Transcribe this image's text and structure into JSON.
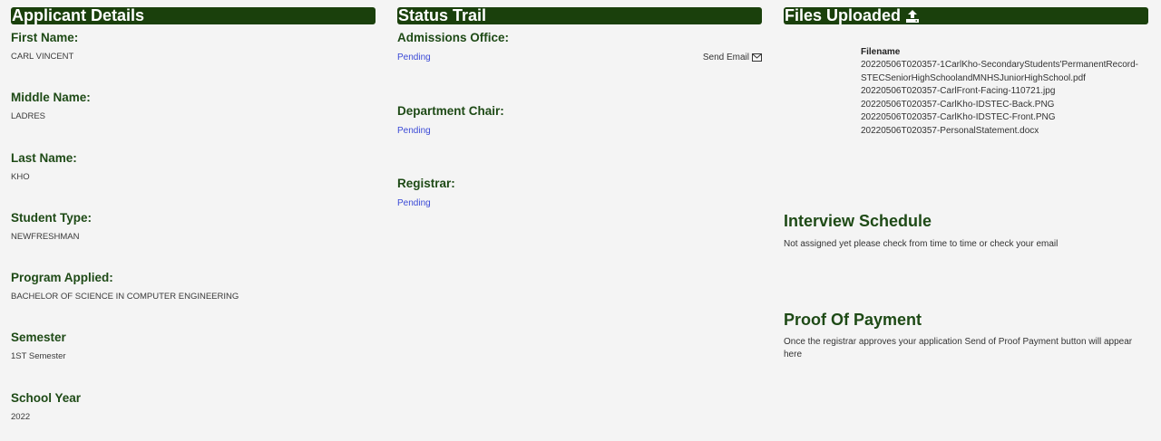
{
  "applicant": {
    "header": "Applicant Details",
    "fields": [
      {
        "label": "First Name:",
        "value": "CARL VINCENT"
      },
      {
        "label": "Middle Name:",
        "value": "LADRES"
      },
      {
        "label": "Last Name:",
        "value": "KHO"
      },
      {
        "label": "Student Type:",
        "value": "NEWFRESHMAN"
      },
      {
        "label": "Program Applied:",
        "value": "BACHELOR OF SCIENCE IN COMPUTER ENGINEERING"
      },
      {
        "label": "Semester",
        "value": "1ST Semester"
      },
      {
        "label": "School Year",
        "value": "2022"
      }
    ]
  },
  "status": {
    "header": "Status Trail",
    "send_email": "Send Email",
    "items": [
      {
        "label": "Admissions Office:",
        "value": "Pending"
      },
      {
        "label": "Department Chair:",
        "value": "Pending"
      },
      {
        "label": "Registrar:",
        "value": "Pending"
      }
    ]
  },
  "files": {
    "header": "Files Uploaded",
    "icon": "upload-icon",
    "column_title": "Filename",
    "items": [
      "20220506T020357-1CarlKho-SecondaryStudents'PermanentRecord-STECSeniorHighSchoolandMNHSJuniorHighSchool.pdf",
      "20220506T020357-CarlFront-Facing-110721.jpg",
      "20220506T020357-CarlKho-IDSTEC-Back.PNG",
      "20220506T020357-CarlKho-IDSTEC-Front.PNG",
      "20220506T020357-PersonalStatement.docx"
    ]
  },
  "interview": {
    "title": "Interview Schedule",
    "text": "Not assigned yet please check from time to time or check your email"
  },
  "payment": {
    "title": "Proof Of Payment",
    "text": "Once the registrar approves your application Send of Proof Payment button will appear here"
  },
  "colors": {
    "header_bg": "#1a400c",
    "label_green": "#1e4a16",
    "pending_blue": "#3b4ad6"
  }
}
